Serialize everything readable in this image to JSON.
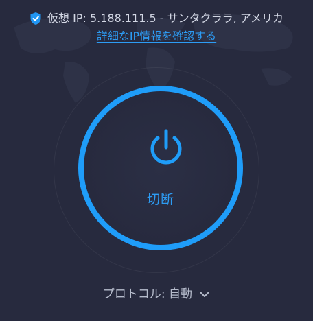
{
  "status": {
    "label": "仮想 IP: 5.188.111.5 - サンタクララ, アメリカ"
  },
  "links": {
    "details": "詳細なIP情報を確認する"
  },
  "connection": {
    "action_label": "切断"
  },
  "protocol": {
    "label": "プロトコル: 自動"
  },
  "icons": {
    "status": "shield-check-icon",
    "main": "power-icon",
    "protocol_toggle": "chevron-down-icon"
  },
  "colors": {
    "background": "#272a3e",
    "accent": "#1f9df9",
    "link": "#2d9cf4",
    "text": "#d3d7e4"
  }
}
